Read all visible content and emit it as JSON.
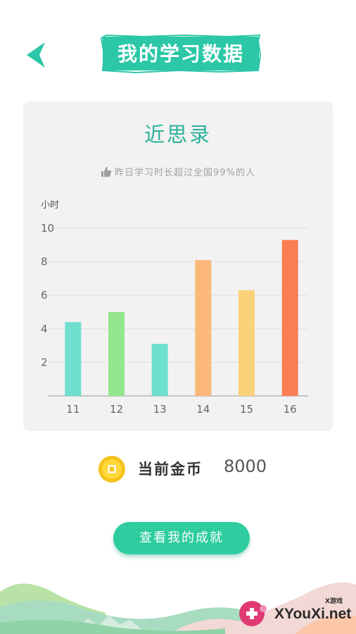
{
  "header": {
    "title": "我的学习数据",
    "back_icon": "chevron-left-icon",
    "accent_color": "#2bc7a7"
  },
  "card": {
    "title": "近思录",
    "subtitle": "昨日学习时长超过全国99%的人",
    "subtitle_icon": "thumbs-up-icon",
    "unit_label": "小时"
  },
  "chart_data": {
    "type": "bar",
    "categories": [
      "11",
      "12",
      "13",
      "14",
      "15",
      "16"
    ],
    "values": [
      4.4,
      5.0,
      3.1,
      8.1,
      6.3,
      9.3
    ],
    "colors": [
      "#6ee0cd",
      "#94e68d",
      "#6ee0cd",
      "#fbb879",
      "#fbd278",
      "#fb7e53"
    ],
    "yticks": [
      2,
      4,
      6,
      8,
      10
    ],
    "ylim": [
      0,
      10
    ],
    "ylabel": "小时",
    "grid": true
  },
  "coins": {
    "label": "当前金币",
    "value": "8000",
    "icon": "coin-icon"
  },
  "button": {
    "label": "查看我的成就"
  },
  "watermark": {
    "text": "XYouXi.net",
    "small": "X游戏"
  }
}
